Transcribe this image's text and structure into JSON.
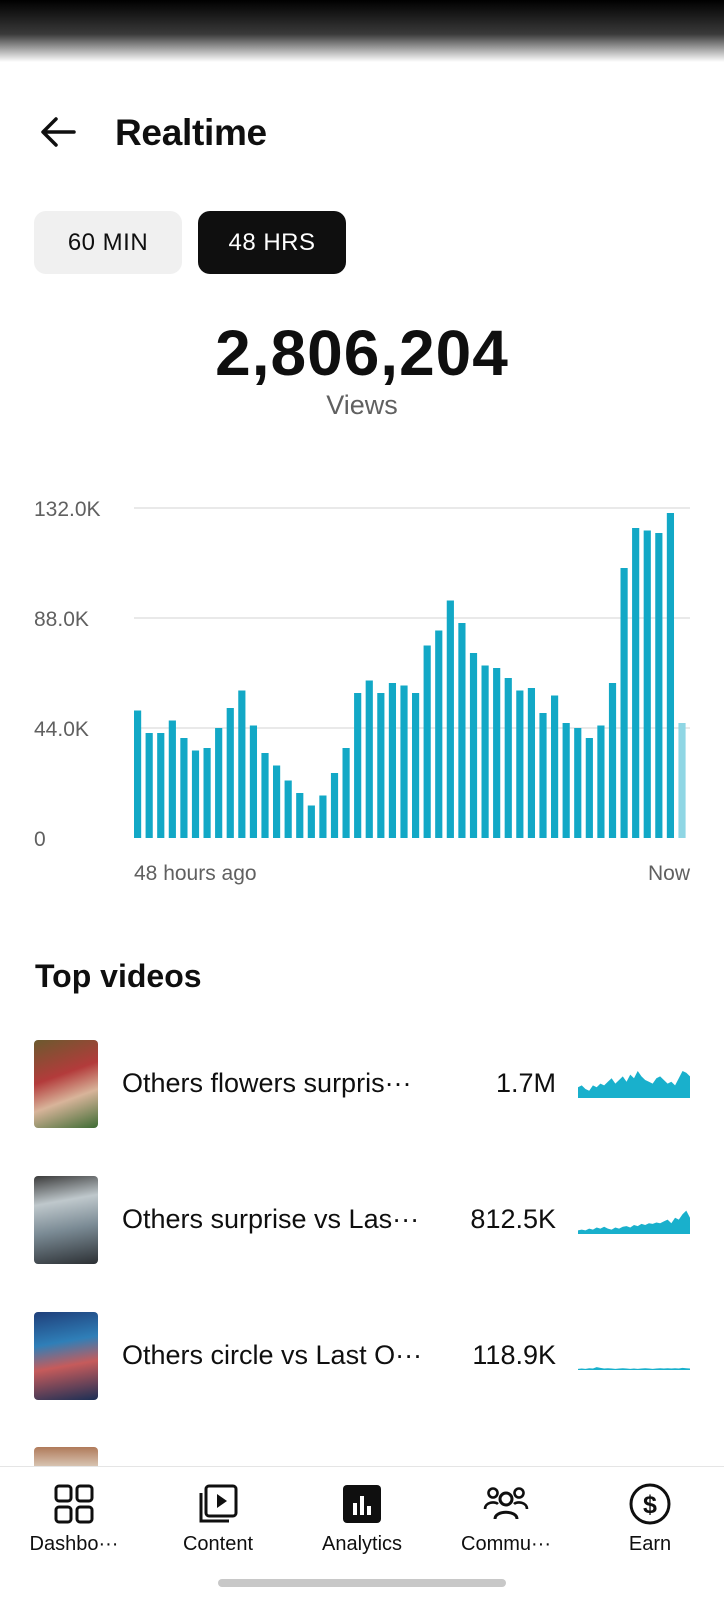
{
  "header": {
    "title": "Realtime",
    "back_icon": "arrow-left-icon"
  },
  "range_toggle": {
    "options": [
      "60 MIN",
      "48 HRS"
    ],
    "selected": "48 HRS"
  },
  "summary": {
    "total": "2,806,204",
    "label": "Views"
  },
  "chart_data": {
    "type": "bar",
    "y_ticks": [
      "132.0K",
      "88.0K",
      "44.0K",
      "0"
    ],
    "ylim": [
      0,
      132000
    ],
    "x_start_label": "48 hours ago",
    "x_end_label": "Now",
    "grid": true,
    "color": "#12a8c6",
    "partial_color": "#8fd6e4",
    "values": [
      51000,
      42000,
      42000,
      47000,
      40000,
      35000,
      36000,
      44000,
      52000,
      59000,
      45000,
      34000,
      29000,
      23000,
      18000,
      13000,
      17000,
      26000,
      36000,
      58000,
      63000,
      58000,
      62000,
      61000,
      58000,
      77000,
      83000,
      95000,
      86000,
      74000,
      69000,
      68000,
      64000,
      59000,
      60000,
      50000,
      57000,
      46000,
      44000,
      40000,
      45000,
      62000,
      108000,
      124000,
      123000,
      122000,
      130000,
      46000
    ]
  },
  "top_videos": {
    "title": "Top videos",
    "items": [
      {
        "title": "Others flowers surpris···",
        "views": "1.7M",
        "spark": [
          0.3,
          0.35,
          0.25,
          0.2,
          0.35,
          0.3,
          0.4,
          0.35,
          0.45,
          0.55,
          0.4,
          0.5,
          0.6,
          0.45,
          0.65,
          0.55,
          0.75,
          0.6,
          0.5,
          0.45,
          0.4,
          0.55,
          0.6,
          0.5,
          0.4,
          0.45,
          0.35,
          0.55,
          0.75,
          0.7,
          0.6
        ]
      },
      {
        "title": "Others surprise vs Las···",
        "views": "812.5K",
        "spark": [
          0.1,
          0.12,
          0.1,
          0.15,
          0.12,
          0.18,
          0.15,
          0.2,
          0.15,
          0.12,
          0.18,
          0.15,
          0.2,
          0.22,
          0.18,
          0.25,
          0.22,
          0.28,
          0.25,
          0.3,
          0.28,
          0.32,
          0.3,
          0.35,
          0.4,
          0.3,
          0.45,
          0.4,
          0.55,
          0.65,
          0.45
        ]
      },
      {
        "title": "Others circle vs Last O···",
        "views": "118.9K",
        "spark": [
          0.03,
          0.04,
          0.03,
          0.05,
          0.04,
          0.08,
          0.06,
          0.04,
          0.05,
          0.04,
          0.03,
          0.04,
          0.05,
          0.04,
          0.03,
          0.04,
          0.03,
          0.04,
          0.05,
          0.04,
          0.03,
          0.04,
          0.05,
          0.04,
          0.05,
          0.04,
          0.05,
          0.04,
          0.06,
          0.05,
          0.04
        ]
      }
    ]
  },
  "bottom_nav": {
    "items": [
      {
        "label": "Dashbo···",
        "icon": "dashboard-icon"
      },
      {
        "label": "Content",
        "icon": "content-play-icon"
      },
      {
        "label": "Analytics",
        "icon": "analytics-icon",
        "active": true
      },
      {
        "label": "Commu···",
        "icon": "community-icon"
      },
      {
        "label": "Earn",
        "icon": "dollar-icon"
      }
    ]
  }
}
